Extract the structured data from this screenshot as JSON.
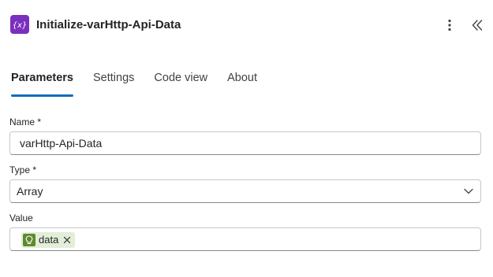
{
  "header": {
    "title": "Initialize-varHttp-Api-Data",
    "icon_glyph": "{x}",
    "icon_color": "#7b2fbe"
  },
  "tabs": [
    {
      "label": "Parameters",
      "active": true
    },
    {
      "label": "Settings",
      "active": false
    },
    {
      "label": "Code view",
      "active": false
    },
    {
      "label": "About",
      "active": false
    }
  ],
  "form": {
    "name_label": "Name",
    "name_value": "varHttp-Api-Data",
    "type_label": "Type",
    "type_value": "Array",
    "value_label": "Value",
    "required_marker": "*",
    "value_token": {
      "label": "data",
      "color": "#5e8a2d"
    }
  },
  "accent_color": "#0f6cbd"
}
